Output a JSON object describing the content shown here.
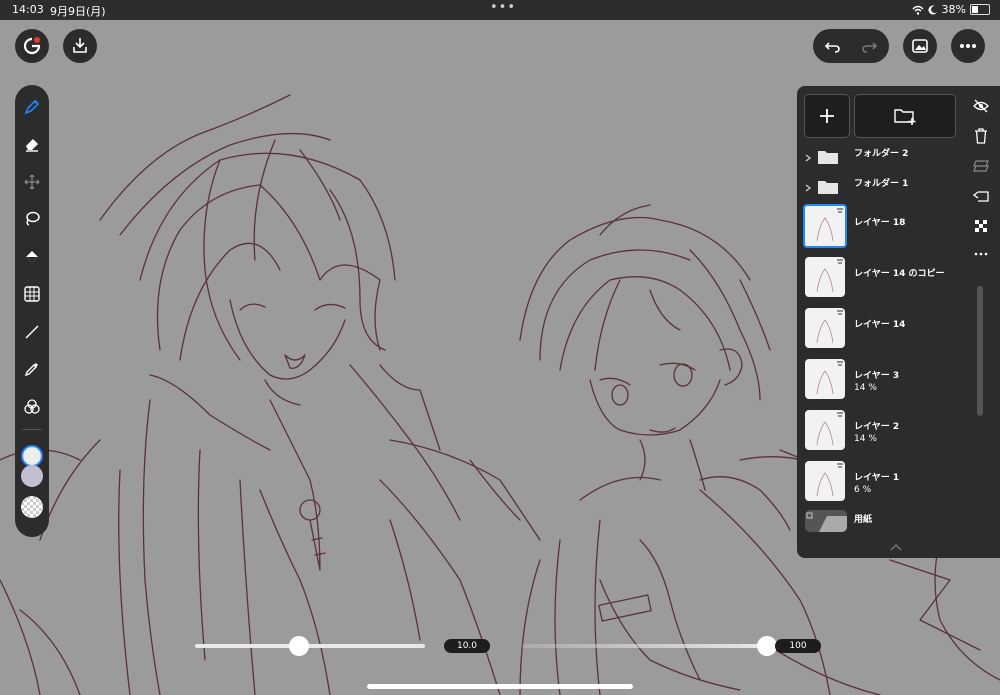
{
  "status_bar": {
    "time": "14:03",
    "date": "9月9日(月)",
    "battery": "38%",
    "battery_level": 0.38
  },
  "layers_panel": {
    "folders": [
      {
        "name": "フォルダー 2"
      },
      {
        "name": "フォルダー 1"
      }
    ],
    "layers": [
      {
        "name": "レイヤー 18",
        "opacity": "",
        "selected": true
      },
      {
        "name": "レイヤー 14 のコピー",
        "opacity": "",
        "selected": false
      },
      {
        "name": "レイヤー 14",
        "opacity": "",
        "selected": false
      },
      {
        "name": "レイヤー 3",
        "opacity": "14 %",
        "selected": false
      },
      {
        "name": "レイヤー 2",
        "opacity": "14 %",
        "selected": false
      },
      {
        "name": "レイヤー 1",
        "opacity": "6 %",
        "selected": false
      }
    ],
    "paper": {
      "name": "用紙"
    }
  },
  "brush": {
    "size_value": "10.0",
    "opacity_value": "100",
    "size_level": 0.45,
    "opacity_level": 1.0
  },
  "colors": {
    "accent": "#1e88ff",
    "stroke": "#5a3238",
    "primary_color": "#ececec",
    "secondary_color": "#c2bfd0"
  },
  "icons": [
    "app-logo-icon",
    "import-icon",
    "undo-icon",
    "redo-icon",
    "gallery-icon",
    "more-icon",
    "pen-icon",
    "eraser-icon",
    "transform-icon",
    "lasso-icon",
    "fill-icon",
    "grid-icon",
    "line-icon",
    "eyedropper-icon",
    "color-circle-icon",
    "add-layer-icon",
    "add-folder-icon",
    "visibility-off-icon",
    "trash-icon",
    "merge-icon",
    "reference-icon",
    "mask-icon"
  ]
}
